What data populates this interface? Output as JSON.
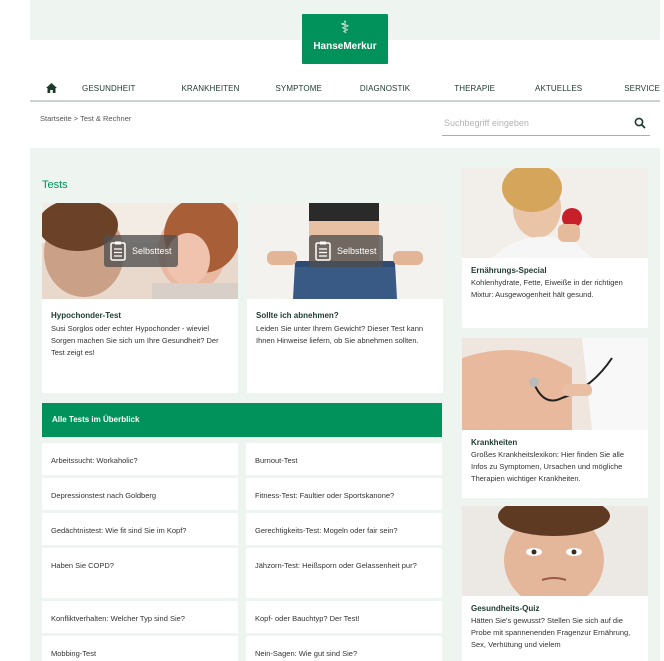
{
  "brand": {
    "name": "HanseMerkur",
    "color": "#00925a"
  },
  "nav": {
    "home_icon": "home-icon",
    "items": [
      "GESUNDHEIT",
      "KRANKHEITEN",
      "SYMPTOME",
      "DIAGNOSTIK",
      "THERAPIE",
      "AKTUELLES",
      "SERVICE"
    ]
  },
  "breadcrumb": "Startseite > Test & Rechner",
  "search": {
    "placeholder": "Suchbegriff eingeben",
    "icon": "search-icon"
  },
  "section_title": "Tests",
  "cards": [
    {
      "badge": "Selbsttest",
      "title": "Hypochonder-Test",
      "text": "Susi Sorglos oder echter Hypochonder - wieviel Sorgen machen Sie sich um Ihre Gesundheit? Der Test zeigt es!"
    },
    {
      "badge": "Selbsttest",
      "title": "Sollte ich abnehmen?",
      "text": "Leiden Sie unter Ihrem Gewicht? Dieser Test kann Ihnen Hinweise liefern, ob Sie abnehmen sollten."
    }
  ],
  "all_tests_label": "Alle Tests im Überblick",
  "tests": [
    "Arbeitssucht: Workaholic?",
    "Burnout-Test",
    "Depressionstest nach Goldberg",
    "Fitness-Test: Faultier oder Sportskanone?",
    "Gedächtnistest: Wie fit sind Sie im Kopf?",
    "Gerechtigkeits-Test: Mogeln oder fair sein?",
    "Haben Sie COPD?",
    "Jähzorn-Test: Heißsporn oder Gelassenheit pur?",
    "Konfliktverhalten: Welcher Typ sind Sie?",
    "Kopf- oder Bauchtyp? Der Test!",
    "Mobbing-Test",
    "Nein-Sagen: Wie gut sind Sie?"
  ],
  "sidebar": [
    {
      "title": "Ernährungs-Special",
      "text": "Kohlenhydrate, Fette, Eiweiße in der richtigen Mixtur: Ausgewogenheit hält gesund."
    },
    {
      "title": "Krankheiten",
      "text": "Großes Krankheitslexikon: Hier finden Sie alle Infos zu Symptomen, Ursachen und mögliche Therapien wichtiger Krankheiten."
    },
    {
      "title": "Gesundheits-Quiz",
      "text": "Hätten Sie's gewusst? Stellen Sie sich auf die Probe mit spannenenden Fragenzur Ernährung, Sex, Verhütung und vielem"
    }
  ]
}
